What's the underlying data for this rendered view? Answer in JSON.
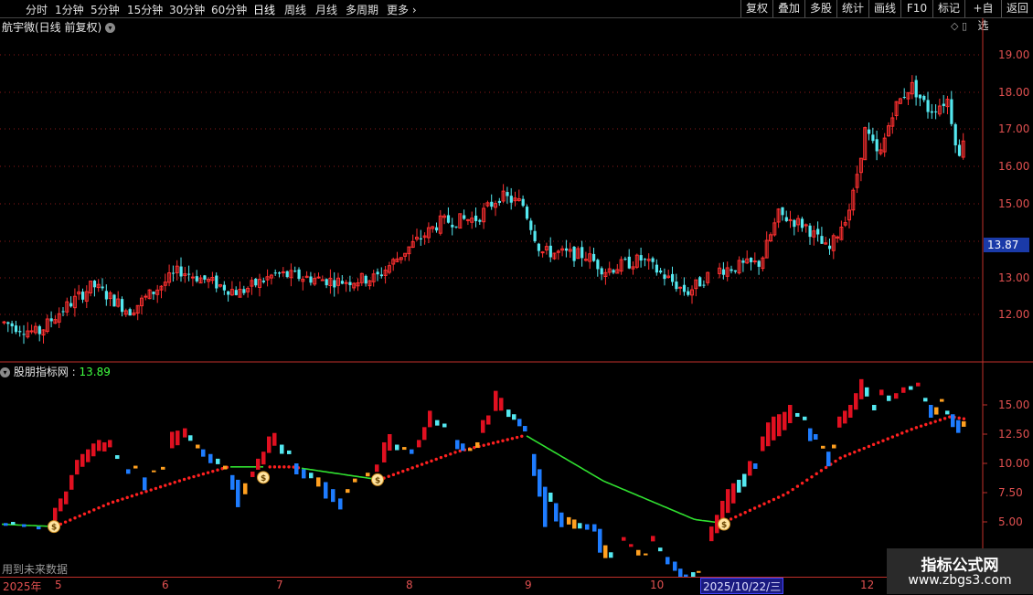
{
  "toolbar": {
    "periods": [
      "分时",
      "1分钟",
      "5分钟",
      "15分钟",
      "30分钟",
      "60分钟",
      "日线",
      "周线",
      "月线",
      "多周期",
      "更多"
    ],
    "more_arrow": "›",
    "right_buttons": [
      "复权",
      "叠加",
      "多股",
      "统计",
      "画线",
      "F10",
      "标记",
      "+自选",
      "返回"
    ]
  },
  "main_chart": {
    "title": "航宇微(日线 前复权)",
    "price_axis_labels": [
      "19.00",
      "18.00",
      "17.00",
      "16.00",
      "15.00",
      "13.00",
      "12.00"
    ],
    "current_price_tag": "13.87"
  },
  "indicator": {
    "name": "股朋指标网",
    "value": "13.89",
    "axis_labels": [
      "15.00",
      "12.50",
      "10.00",
      "7.50",
      "5.00"
    ],
    "note": "用到未来数据"
  },
  "date_axis": {
    "labels": [
      "2025年",
      "5",
      "6",
      "7",
      "8",
      "9",
      "10",
      "12"
    ],
    "cursor_date": "2025/10/22/三"
  },
  "watermark": {
    "title": "指标公式网",
    "url": "www.zbgs3.com"
  },
  "colors": {
    "up": "#ff3030",
    "down": "#54e8f0",
    "bar_red": "#e01020",
    "bar_blue": "#1e7cff",
    "bar_cyan": "#54e8f0",
    "bar_orange": "#ffa020",
    "dots": "#ff2020",
    "green_line": "#30e030",
    "grid": "#8b1a1a"
  }
}
